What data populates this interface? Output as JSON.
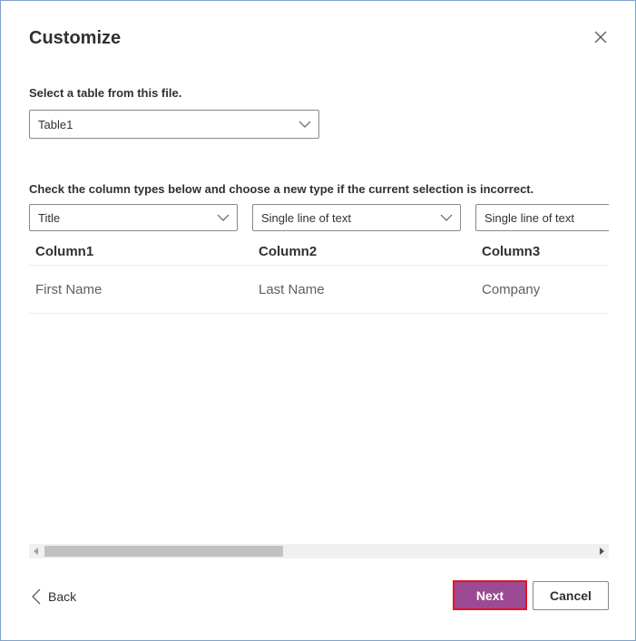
{
  "dialog": {
    "title": "Customize",
    "close_icon": "close-icon"
  },
  "table_select": {
    "label": "Select a table from this file.",
    "selected": "Table1"
  },
  "columns_section": {
    "instructions": "Check the column types below and choose a new type if the current selection is incorrect.",
    "columns": [
      {
        "type": "Title",
        "header": "Column1",
        "value": "First Name"
      },
      {
        "type": "Single line of text",
        "header": "Column2",
        "value": "Last Name"
      },
      {
        "type": "Single line of text",
        "header": "Column3",
        "value": "Company"
      }
    ]
  },
  "footer": {
    "back_label": "Back",
    "next_label": "Next",
    "cancel_label": "Cancel"
  },
  "colors": {
    "primary": "#9c4a93",
    "highlight_border": "#e81123"
  }
}
